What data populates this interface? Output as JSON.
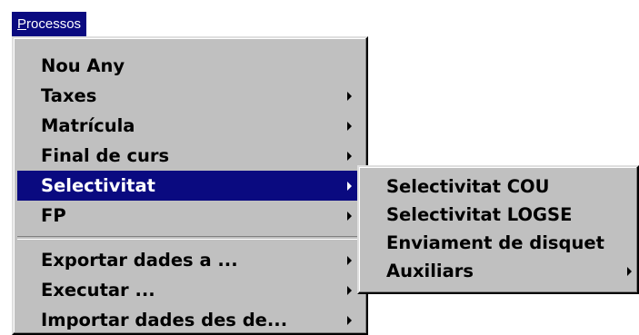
{
  "menubar": {
    "title_mnemonic": "P",
    "title_rest": "rocessos"
  },
  "main_menu": {
    "items": [
      {
        "label": "Nou Any",
        "submenu": false
      },
      {
        "label": "Taxes",
        "submenu": true
      },
      {
        "label": "Matrícula",
        "submenu": true
      },
      {
        "label": "Final de curs",
        "submenu": true
      },
      {
        "label": "Selectivitat",
        "submenu": true,
        "highlighted": true
      },
      {
        "label": "FP",
        "submenu": true
      },
      {
        "label": "Exportar dades a ...",
        "submenu": true
      },
      {
        "label": "Executar  ...",
        "submenu": true
      },
      {
        "label": "Importar dades des de...",
        "submenu": true
      }
    ]
  },
  "sub_menu": {
    "items": [
      {
        "label": "Selectivitat COU",
        "submenu": false
      },
      {
        "label": "Selectivitat LOGSE",
        "submenu": false
      },
      {
        "label": "Enviament de disquet",
        "submenu": false
      },
      {
        "label": "Auxiliars",
        "submenu": true
      }
    ]
  },
  "colors": {
    "highlight": "#0a0a80",
    "menu_face": "#c0c0c0",
    "text": "#000000",
    "highlight_text": "#ffffff"
  },
  "icons": {
    "submenu_indicator": "chevron-right-icon"
  }
}
